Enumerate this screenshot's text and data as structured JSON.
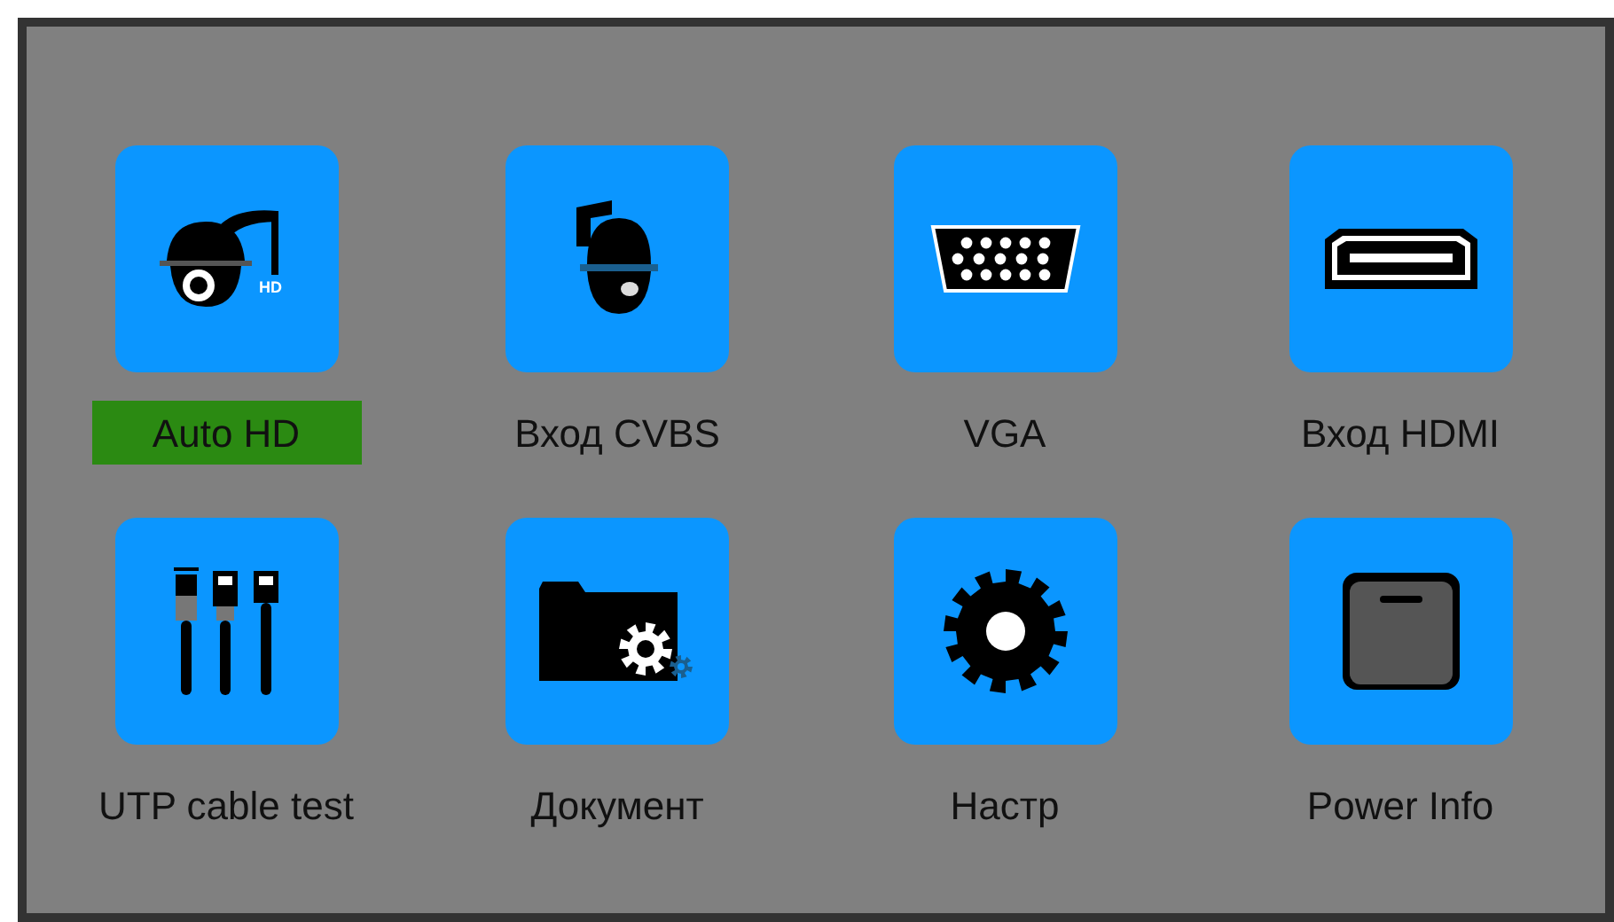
{
  "menu_items": [
    {
      "label": "Auto HD",
      "kind": "ptz-hd",
      "badge": "HD",
      "selected": true
    },
    {
      "label": "Вход CVBS",
      "kind": "dome",
      "selected": false
    },
    {
      "label": "VGA",
      "kind": "vga",
      "selected": false
    },
    {
      "label": "Вход HDMI",
      "kind": "hdmi",
      "selected": false
    },
    {
      "label": "UTP cable test",
      "kind": "cables",
      "selected": false
    },
    {
      "label": "Документ",
      "kind": "folder",
      "selected": false
    },
    {
      "label": "Настр",
      "kind": "gear",
      "selected": false
    },
    {
      "label": "Power Info",
      "kind": "battery",
      "selected": false
    }
  ]
}
